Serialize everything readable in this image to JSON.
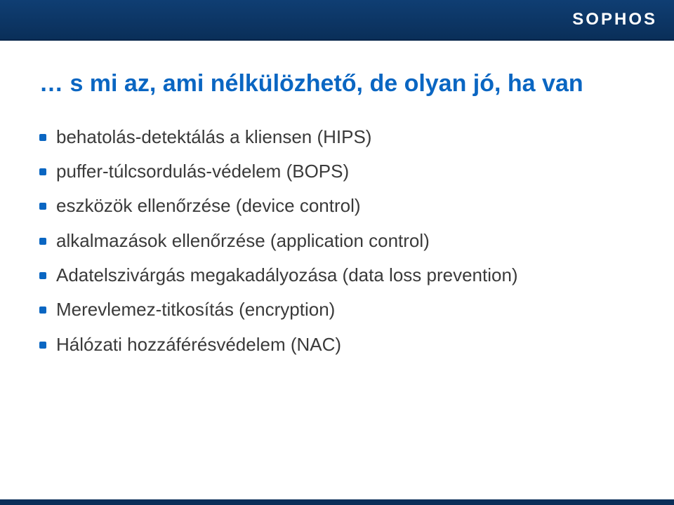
{
  "header": {
    "logo_text": "SOPHOS"
  },
  "slide": {
    "title": "… s mi az, ami nélkülözhető, de olyan jó, ha van",
    "bullets": [
      "behatolás-detektálás a kliensen (HIPS)",
      "puffer-túlcsordulás-védelem (BOPS)",
      "eszközök ellenőrzése (device control)",
      "alkalmazások ellenőrzése (application control)",
      "Adatelszivárgás megakadályozása (data loss prevention)",
      "Merevlemez-titkosítás (encryption)",
      "Hálózati hozzáférésvédelem (NAC)"
    ]
  }
}
